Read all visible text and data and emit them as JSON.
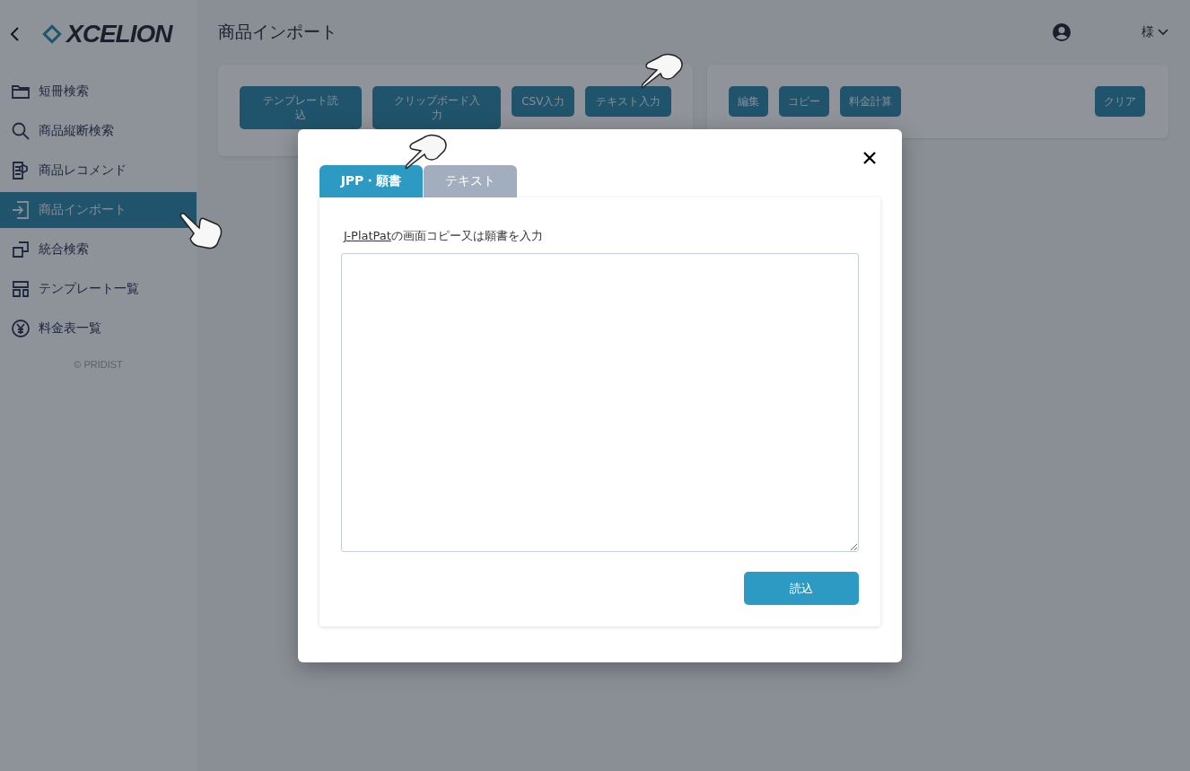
{
  "sidebar": {
    "logo": "XCELION",
    "items": [
      {
        "label": "短冊検索",
        "selected": false
      },
      {
        "label": "商品縦断検索",
        "selected": false
      },
      {
        "label": "商品レコメンド",
        "selected": false
      },
      {
        "label": "商品インポート",
        "selected": true
      },
      {
        "label": "統合検索",
        "selected": false
      },
      {
        "label": "テンプレート一覧",
        "selected": false
      },
      {
        "label": "料金表一覧",
        "selected": false
      }
    ],
    "footer": "© PRIDIST"
  },
  "header": {
    "title": "商品インポート",
    "user": "様"
  },
  "import_buttons": [
    "テンプレート読込",
    "クリップボード入力",
    "CSV入力",
    "テキスト入力"
  ],
  "action_buttons": [
    "編集",
    "コピー",
    "料金計算"
  ],
  "clear_button": "クリア",
  "modal": {
    "tabs": [
      {
        "label": "JPP・願書",
        "selected": true
      },
      {
        "label": "テキスト",
        "selected": false
      }
    ],
    "instruction_link": "J-PlatPat",
    "instruction_rest": "の画面コピー又は願書を入力",
    "submit": "読込"
  }
}
